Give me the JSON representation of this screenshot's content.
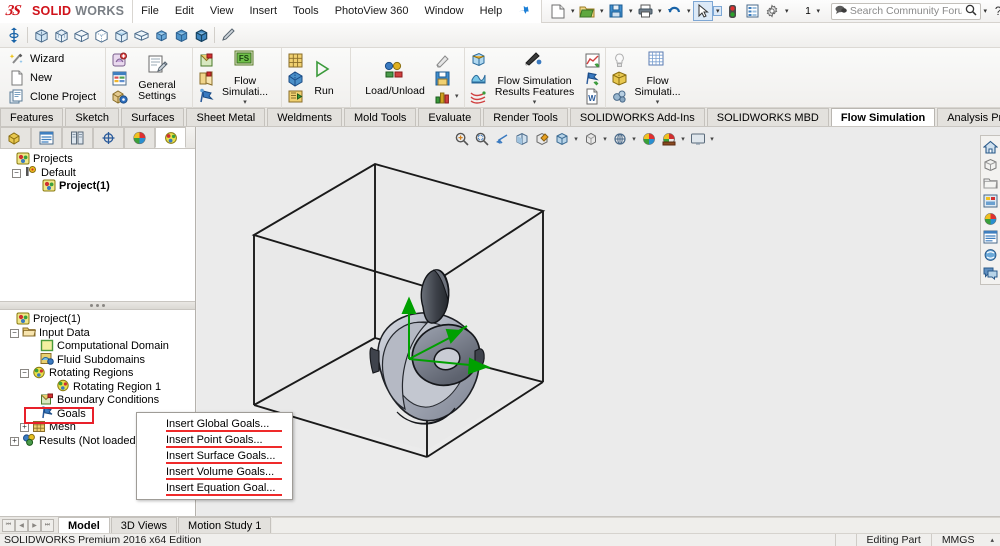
{
  "app": {
    "brand_solid": "SOLID",
    "brand_works": "WORKS",
    "brand_mark": "ĐS"
  },
  "menubar": {
    "items": [
      {
        "label": "File"
      },
      {
        "label": "Edit"
      },
      {
        "label": "View"
      },
      {
        "label": "Insert"
      },
      {
        "label": "Tools"
      },
      {
        "label": "PhotoView 360"
      },
      {
        "label": "Window"
      },
      {
        "label": "Help"
      }
    ],
    "pin_icon": "pushpin-icon"
  },
  "quick_toolbar": {
    "buttons": [
      {
        "name": "new-document-icon",
        "caret": true
      },
      {
        "name": "open-document-icon",
        "caret": true
      },
      {
        "name": "save-icon",
        "caret": true
      },
      {
        "name": "print-icon",
        "caret": true
      },
      {
        "name": "undo-icon",
        "caret": true
      },
      {
        "name": "select-arrow-icon",
        "caret": true,
        "selected": true
      },
      {
        "name": "rebuild-icon",
        "caret": false
      },
      {
        "name": "file-properties-icon",
        "caret": false
      },
      {
        "name": "options-gear-icon",
        "caret": true
      }
    ],
    "config_label": "1"
  },
  "search": {
    "placeholder": "Search Community Forum",
    "icon": "search-icon",
    "forum_icon": "community-forum-icon",
    "caret": "▾"
  },
  "window_controls": {
    "help": "?",
    "help_caret": "▾",
    "minimize": "–",
    "restore": "❐",
    "close": "✕"
  },
  "view_toolbar": {
    "items": [
      {
        "name": "origin-icon"
      },
      {
        "name": "isometric-view-icon"
      },
      {
        "name": "trimetric-view-icon"
      },
      {
        "name": "dimetric-view-icon"
      },
      {
        "name": "front-view-icon"
      },
      {
        "name": "top-view-icon"
      },
      {
        "name": "right-view-icon"
      },
      {
        "name": "shaded-sphere-icon"
      },
      {
        "name": "shaded-cube-icon"
      },
      {
        "name": "shaded-with-edges-icon"
      },
      {
        "name": "appearance-brush-icon"
      }
    ]
  },
  "ribbon": {
    "groups": [
      {
        "name": "project-group",
        "items": [
          {
            "label": "Wizard",
            "icon": "wizard-wand-icon"
          },
          {
            "label": "New",
            "icon": "new-page-icon"
          },
          {
            "label": "Clone Project",
            "icon": "clone-project-icon"
          }
        ]
      },
      {
        "name": "settings-group",
        "small": [
          {
            "icon": "add-fluid-icon"
          },
          {
            "icon": "engineering-database-icon"
          },
          {
            "icon": "component-control-icon"
          }
        ],
        "big": {
          "label": "General Settings",
          "icon": "general-settings-icon"
        }
      },
      {
        "name": "conditions-group",
        "small": [
          {
            "icon": "boundary-condition-icon"
          },
          {
            "icon": "fan-icon"
          },
          {
            "icon": "goals-flag-icon"
          }
        ],
        "big": {
          "label": "Flow Simulati...",
          "icon": "flow-simulation-green-icon"
        },
        "caret": "▾"
      },
      {
        "name": "run-group",
        "small": [
          {
            "icon": "mesh-grid-icon"
          },
          {
            "icon": "solve-icon"
          },
          {
            "icon": "batch-run-icon"
          }
        ],
        "big": {
          "label": "Run",
          "icon": "run-play-icon"
        }
      },
      {
        "name": "loadunload-group",
        "big": {
          "label": "Load/Unload",
          "icon": "load-unload-icon"
        },
        "small": [
          {
            "icon": "results-pen-icon"
          },
          {
            "icon": "save-results-icon"
          },
          {
            "icon": "report-bar-icon",
            "caret": "▾"
          }
        ]
      },
      {
        "name": "results-group",
        "small": [
          {
            "icon": "cut-plot-icon"
          },
          {
            "icon": "surface-plot-icon"
          },
          {
            "icon": "flow-trajectories-icon"
          }
        ],
        "big": {
          "label": "Flow Simulation Results Features",
          "icon": "results-pen-blue-icon"
        },
        "right": [
          {
            "icon": "xy-plot-icon"
          },
          {
            "icon": "goal-plot-icon"
          },
          {
            "icon": "report-word-icon"
          }
        ],
        "caret": "▾"
      },
      {
        "name": "display-group",
        "small": [
          {
            "icon": "lightbulb-icon"
          },
          {
            "icon": "display-mesh-icon"
          },
          {
            "icon": "tools-gear-icon"
          }
        ],
        "big": {
          "label": "Flow Simulati...",
          "icon": "flow-sim-display-icon",
          "selected": true
        },
        "caret": "▾"
      }
    ]
  },
  "command_tabs": {
    "tabs": [
      {
        "label": "Features",
        "active": false
      },
      {
        "label": "Sketch",
        "active": false
      },
      {
        "label": "Surfaces",
        "active": false
      },
      {
        "label": "Sheet Metal",
        "active": false
      },
      {
        "label": "Weldments",
        "active": false
      },
      {
        "label": "Mold Tools",
        "active": false
      },
      {
        "label": "Evaluate",
        "active": false
      },
      {
        "label": "Render Tools",
        "active": false
      },
      {
        "label": "SOLIDWORKS Add-Ins",
        "active": false
      },
      {
        "label": "SOLIDWORKS MBD",
        "active": false
      },
      {
        "label": "Flow Simulation",
        "active": true
      },
      {
        "label": "Analysis Preparation",
        "active": false
      }
    ],
    "window_buttons": [
      {
        "name": "restore-left-icon",
        "glyph": "◱"
      },
      {
        "name": "restore-right-icon",
        "glyph": "◰"
      },
      {
        "name": "minimize-doc-icon",
        "glyph": "–"
      },
      {
        "name": "restore-doc-icon",
        "glyph": "❐"
      },
      {
        "name": "close-doc-icon",
        "glyph": "✕"
      }
    ]
  },
  "panel_tabs": [
    {
      "name": "feature-manager-tab",
      "icon": "feature-tree-icon",
      "active": false
    },
    {
      "name": "property-manager-tab",
      "icon": "property-list-icon",
      "active": false
    },
    {
      "name": "configuration-manager-tab",
      "icon": "configuration-icon",
      "active": false
    },
    {
      "name": "dimxpert-tab",
      "icon": "dimxpert-icon",
      "active": false
    },
    {
      "name": "display-manager-tab",
      "icon": "display-palette-icon",
      "active": false
    },
    {
      "name": "flow-simulation-tab",
      "icon": "flow-simulation-tree-icon",
      "active": true
    }
  ],
  "project_tree": {
    "nodes": [
      {
        "label": "Projects",
        "level": 0,
        "icon": "flow-project-icon",
        "expander": null,
        "bold": false
      },
      {
        "label": "Default",
        "level": 1,
        "icon": "default-config-icon",
        "expander": "−",
        "bold": false
      },
      {
        "label": "Project(1)",
        "level": 2,
        "icon": "flow-project-icon",
        "expander": null,
        "bold": true
      }
    ]
  },
  "study_tree": {
    "nodes": [
      {
        "label": "Project(1)",
        "level": 0,
        "icon": "flow-project-icon",
        "expander": null,
        "bold": false
      },
      {
        "label": "Input Data",
        "level": 1,
        "icon": "input-data-folder-icon",
        "expander": "−",
        "bold": false
      },
      {
        "label": "Computational Domain",
        "level": 2,
        "icon": "computational-domain-icon",
        "expander": null,
        "bold": false
      },
      {
        "label": "Fluid Subdomains",
        "level": 2,
        "icon": "fluid-subdomain-icon",
        "expander": null,
        "bold": false
      },
      {
        "label": "Rotating Regions",
        "level": 2,
        "icon": "rotating-region-icon",
        "expander": "−",
        "bold": false
      },
      {
        "label": "Rotating Region 1",
        "level": 3,
        "icon": "rotating-region-icon",
        "expander": null,
        "bold": false
      },
      {
        "label": "Boundary Conditions",
        "level": 2,
        "icon": "boundary-conditions-icon",
        "expander": null,
        "bold": false
      },
      {
        "label": "Goals",
        "level": 2,
        "icon": "goals-flag-icon",
        "expander": null,
        "bold": false,
        "highlighted": true
      },
      {
        "label": "Mesh",
        "level": 2,
        "icon": "mesh-icon",
        "expander": "+",
        "bold": false
      },
      {
        "label": "Results (Not loaded)",
        "level": 1,
        "icon": "results-icon",
        "expander": "+",
        "bold": false
      }
    ]
  },
  "context_menu": {
    "items": [
      {
        "label": "Insert Global Goals..."
      },
      {
        "label": "Insert Point Goals..."
      },
      {
        "label": "Insert Surface Goals..."
      },
      {
        "label": "Insert Volume Goals..."
      },
      {
        "label": "Insert Equation Goal..."
      }
    ],
    "underline_color": "#ef2a2a"
  },
  "viewport_toolbar": {
    "items": [
      {
        "name": "zoom-to-fit-icon",
        "caret": false
      },
      {
        "name": "zoom-to-area-icon",
        "caret": false
      },
      {
        "name": "previous-view-icon",
        "caret": false
      },
      {
        "name": "section-view-icon",
        "caret": false
      },
      {
        "name": "view-orientation-icon",
        "caret": false
      },
      {
        "name": "display-style-icon",
        "caret": true
      },
      {
        "name": "hide-show-items-icon",
        "caret": true
      },
      {
        "name": "edit-appearance-icon",
        "caret": true
      },
      {
        "name": "apply-scene-icon",
        "caret": false
      },
      {
        "name": "view-settings-icon",
        "caret": true
      },
      {
        "name": "viewport-layout-icon",
        "caret": true
      }
    ]
  },
  "right_dock": {
    "items": [
      {
        "name": "home-icon"
      },
      {
        "name": "design-library-icon"
      },
      {
        "name": "file-explorer-icon"
      },
      {
        "name": "view-palette-icon"
      },
      {
        "name": "appearances-scenes-icon"
      },
      {
        "name": "custom-properties-icon"
      },
      {
        "name": "solidworks-forum-icon"
      },
      {
        "name": "feedback-icon"
      }
    ]
  },
  "bottom_tabs": {
    "nav": [
      "⏮",
      "◀",
      "▶",
      "⏭"
    ],
    "tabs": [
      {
        "label": "Model",
        "active": true
      },
      {
        "label": "3D Views",
        "active": false
      },
      {
        "label": "Motion Study 1",
        "active": false
      }
    ]
  },
  "status_bar": {
    "left": "SOLIDWORKS Premium 2016 x64 Edition",
    "editing": "Editing Part",
    "units": "MMGS",
    "arrow": "▴"
  },
  "colors": {
    "accent_red": "#d0121a",
    "highlight_red": "#e8202a",
    "menu_underline": "#ef2a2a",
    "viewport_bg": "#ebebeb",
    "model_arrow_green": "#00a000",
    "tab_active_bg": "#ffffff"
  },
  "model": {
    "name": "impeller-rotor-model",
    "domain_box": "computational-domain-wireframe",
    "axis_arrows": "rotation-axis-triad"
  }
}
